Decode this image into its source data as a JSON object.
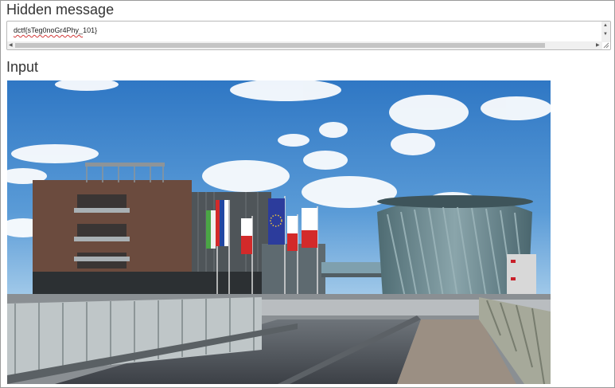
{
  "hidden_message": {
    "heading": "Hidden message",
    "value_spellchecked": "dctf{sTeg0noGr4Phy_",
    "value_rest": "101}"
  },
  "input": {
    "heading": "Input"
  },
  "icons": {
    "scroll_up": "triangle-up",
    "scroll_down": "triangle-down",
    "scroll_left": "triangle-left",
    "scroll_right": "triangle-right",
    "resize": "resize-grip"
  },
  "colors": {
    "sky_top": "#2f77c4",
    "sky_bottom": "#8fc2ea",
    "building_brown": "#6b4b3e",
    "glass_building": "#6d8a90",
    "spellcheck": "#d23a3a"
  }
}
